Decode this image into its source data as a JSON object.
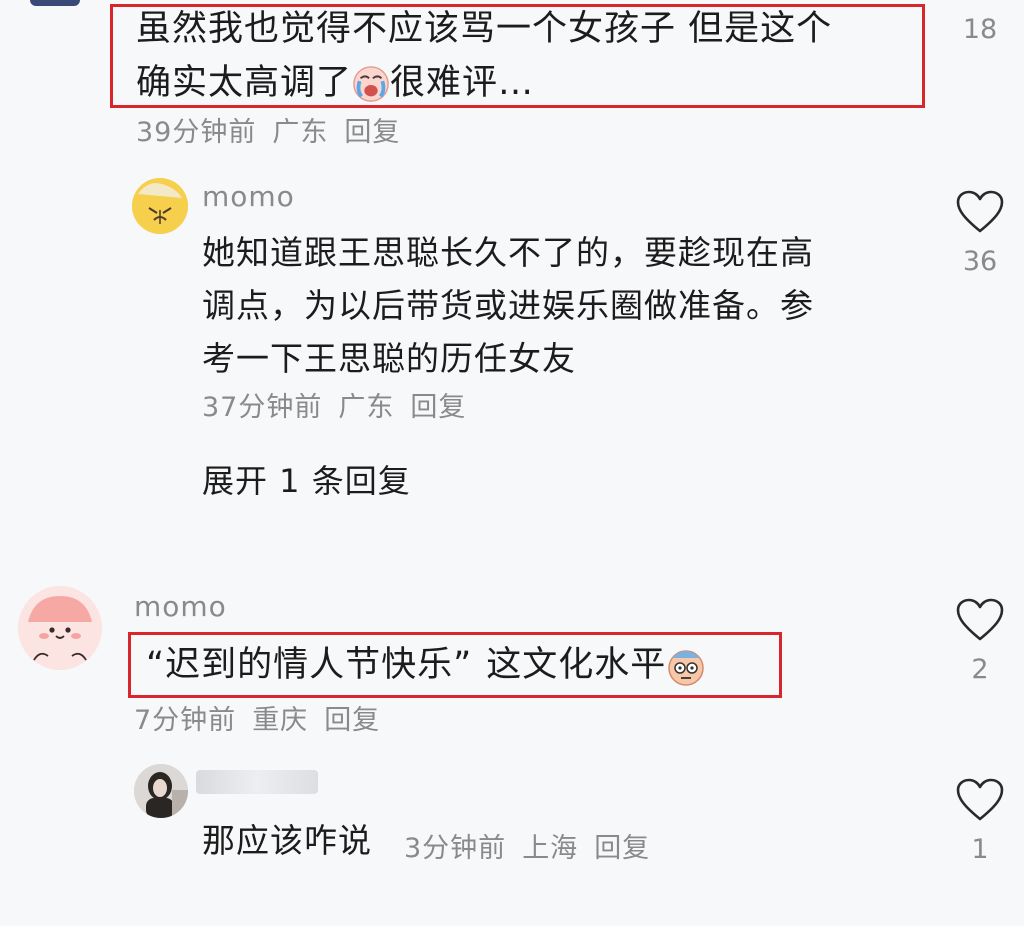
{
  "comments": [
    {
      "text_line1": "虽然我也觉得不应该骂一个女孩子 但是这个",
      "text_line2_a": "确实太高调了",
      "text_line2_b": "很难评…",
      "emoji": "crying-face-emoji",
      "meta": {
        "time": "39分钟前",
        "location": "广东",
        "reply": "回复"
      },
      "likes": "18"
    },
    {
      "username": "momo",
      "text_line1": "她知道跟王思聪长久不了的，要趁现在高",
      "text_line2": "调点，为以后带货或进娱乐圈做准备。参",
      "text_line3": "考一下王思聪的历任女友",
      "meta": {
        "time": "37分钟前",
        "location": "广东",
        "reply": "回复"
      },
      "likes": "36",
      "expand": "展开 1 条回复"
    },
    {
      "username": "momo",
      "text_a": "“迟到的情人节快乐”",
      "text_b": "这文化水平",
      "emoji": "speechless-face-emoji",
      "meta": {
        "time": "7分钟前",
        "location": "重庆",
        "reply": "回复"
      },
      "likes": "2"
    },
    {
      "text": "那应该咋说",
      "meta": {
        "time": "3分钟前",
        "location": "上海",
        "reply": "回复"
      },
      "likes": "1"
    }
  ],
  "icons": {
    "like": "heart-outline-icon"
  },
  "colors": {
    "highlight": "#d8262c",
    "meta": "#8a8a8a",
    "background": "#f7f8fa"
  }
}
